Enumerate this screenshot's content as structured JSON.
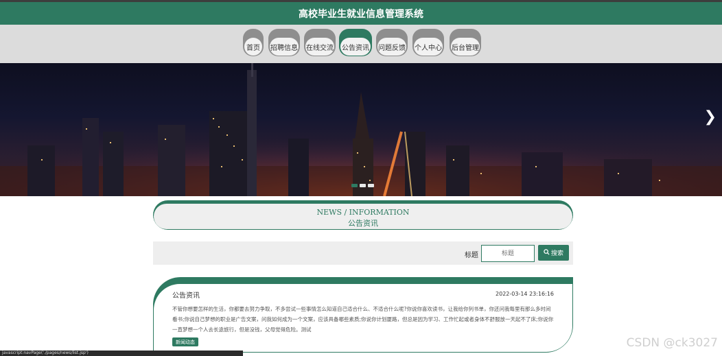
{
  "header": {
    "title": "高校毕业生就业信息管理系统"
  },
  "nav": {
    "items": [
      {
        "label": "首页",
        "active": false
      },
      {
        "label": "招聘信息",
        "active": false
      },
      {
        "label": "在线交流",
        "active": false
      },
      {
        "label": "公告资讯",
        "active": true
      },
      {
        "label": "问题反馈",
        "active": false
      },
      {
        "label": "个人中心",
        "active": false
      },
      {
        "label": "后台管理",
        "active": false
      }
    ]
  },
  "banner": {
    "next_icon": "chevron-right-icon",
    "slides": 3,
    "active_slide": 1
  },
  "section": {
    "title_en": "NEWS / INFORMATION",
    "title_cn": "公告资讯"
  },
  "search": {
    "label": "标题",
    "placeholder": "标题",
    "button_label": "搜索",
    "button_icon": "search-icon"
  },
  "news": [
    {
      "title": "公告资讯",
      "time": "2022-03-14 23:16:16",
      "body": "不管你想要怎样的生活，你都要去努力争取，不多尝试一些事情怎么知道自己适合什么、不适合什么呢?你说你喜欢读书，让我给你列书单，你还问我每里有那么多时间看书;你说自己梦想的职业是广告文案，问我如何成为一个文案，应该具备哪些素质;你说你计划厦路，但总是因为学习、工作忙起或者身体不舒服放一天起不了床;你说你一直梦想一个人去长途旅行，但是没钱，父母觉得危险。测试",
      "tag": "新闻动态"
    }
  ],
  "status_bar": {
    "url": "javascript:navPage('./pages/news/list.jsp')"
  },
  "watermark": "CSDN @ck3027",
  "colors": {
    "accent": "#2e7a61",
    "nav_bg": "#dcdcdc",
    "search_bg": "#eeeeee"
  }
}
